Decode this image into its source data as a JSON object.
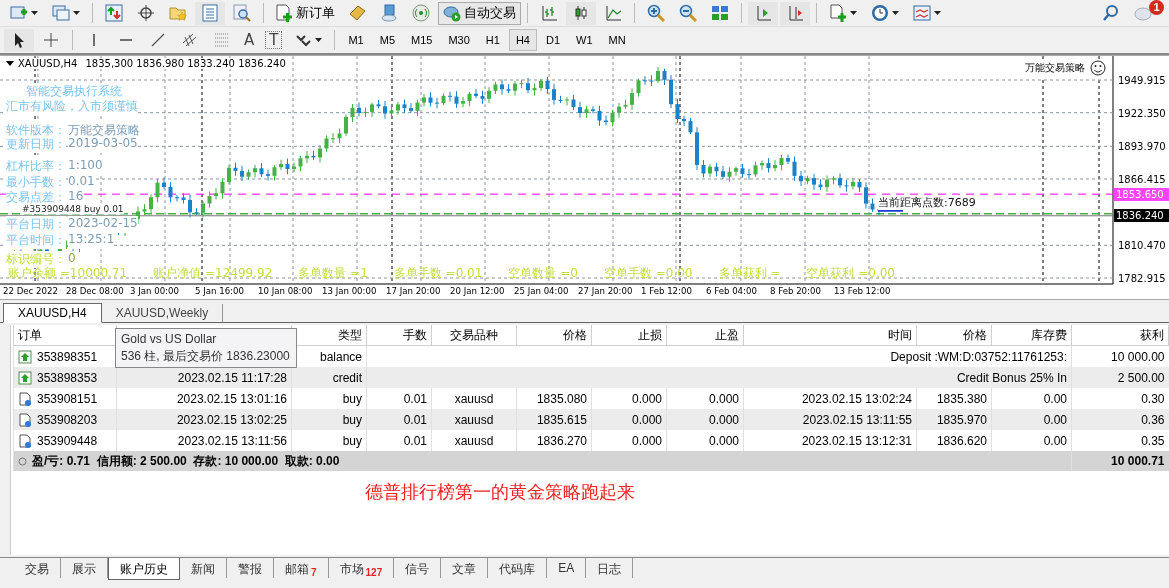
{
  "toolbar": {
    "new_order": "新订单",
    "auto_trading": "自动交易",
    "timeframes": [
      {
        "label": "M1",
        "selected": false
      },
      {
        "label": "M5",
        "selected": false
      },
      {
        "label": "M15",
        "selected": false
      },
      {
        "label": "M30",
        "selected": false
      },
      {
        "label": "H1",
        "selected": false
      },
      {
        "label": "H4",
        "selected": true
      },
      {
        "label": "D1",
        "selected": false
      },
      {
        "label": "W1",
        "selected": false
      },
      {
        "label": "MN",
        "selected": false
      }
    ],
    "text_tools": [
      "A",
      "T"
    ],
    "notification_count": "1"
  },
  "chart": {
    "symbol": "XAUUSD,H4",
    "ohlc": "1835,300 1836.980 1833.240 1836.240",
    "top_right": "万能交易策略",
    "info_lines": [
      {
        "kind": "heading",
        "label": "智能交易执行系统"
      },
      {
        "kind": "heading",
        "label": "汇市有风险，入市须谨慎"
      },
      {
        "kind": "field",
        "label": "软件版本：",
        "value": "万能交易策略"
      },
      {
        "kind": "field",
        "label": "更新日期：",
        "value": "2019-03-05"
      },
      {
        "kind": "field",
        "label": "杠杆比率：",
        "value": "1:100"
      },
      {
        "kind": "field",
        "label": "最小手数：",
        "value": "0.01"
      },
      {
        "kind": "field",
        "label": "交易点差：",
        "value": "16"
      },
      {
        "kind": "field",
        "label": "平台日期：",
        "value": "2023-02-15"
      },
      {
        "kind": "field",
        "label": "平台时间：",
        "value": "13:25:1"
      },
      {
        "kind": "id",
        "label": "标识编号：",
        "value": "0"
      }
    ],
    "trade_label": "#353909448 buy 0.01",
    "distance_label": "当前距离点数:7689",
    "stats": [
      "账户余额 =10000.71",
      "账户净值 =12499.92",
      "多单数量 =1",
      "多单手数 =0.01",
      "空单数量 =0",
      "空单手数 =0.00",
      "多单获利 =",
      "空单获利 =0.00"
    ],
    "price_labels": [
      "1949.915",
      "1922.350",
      "1893.970",
      "1866.415",
      "1810.470",
      "1782.915"
    ],
    "ask_badge": "1853.650",
    "bid_badge": "1836.240",
    "time_labels": [
      "22 Dec 2022",
      "28 Dec 08:00",
      "3 Jan 00:00",
      "5 Jan 16:00",
      "10 Jan 08:00",
      "13 Jan 00:00",
      "17 Jan 20:00",
      "20 Jan 12:00",
      "25 Jan 04:00",
      "27 Jan 20:00",
      "1 Feb 12:00",
      "6 Feb 04:00",
      "8 Feb 20:00",
      "13 Feb 12:00"
    ]
  },
  "chart_tabs": [
    {
      "label": "XAUUSD,H4",
      "selected": true
    },
    {
      "label": "XAUUSD,Weekly",
      "selected": false
    }
  ],
  "terminal": {
    "columns": [
      "订单",
      "",
      "类型",
      "手数",
      "交易品种",
      "价格",
      "止损",
      "止盈",
      "时间",
      "价格",
      "库存费",
      "获利"
    ],
    "tooltip": {
      "title": "Gold vs US Dollar",
      "detail": "536 柱, 最后交易价 1836.23000"
    },
    "rows": [
      {
        "kind": "deposit",
        "order": "353898351",
        "open_time": "",
        "type": "balance",
        "comment": "Deposit :WM:D:03752:11761253:",
        "profit": "10 000.00"
      },
      {
        "kind": "deposit",
        "order": "353898353",
        "open_time": "2023.02.15 11:17:28",
        "type": "credit",
        "comment": "Credit Bonus 25% In",
        "profit": "2 500.00"
      },
      {
        "kind": "trade",
        "order": "353908151",
        "open_time": "2023.02.15 13:01:16",
        "type": "buy",
        "lots": "0.01",
        "symbol": "xauusd",
        "price": "1835.080",
        "sl": "0.000",
        "tp": "0.000",
        "close_time": "2023.02.15 13:02:24",
        "close_price": "1835.380",
        "swap": "0.00",
        "profit": "0.30"
      },
      {
        "kind": "trade",
        "order": "353908203",
        "open_time": "2023.02.15 13:02:25",
        "type": "buy",
        "lots": "0.01",
        "symbol": "xauusd",
        "price": "1835.615",
        "sl": "0.000",
        "tp": "0.000",
        "close_time": "2023.02.15 13:11:55",
        "close_price": "1835.970",
        "swap": "0.00",
        "profit": "0.36"
      },
      {
        "kind": "trade",
        "order": "353909448",
        "open_time": "2023.02.15 13:11:56",
        "type": "buy",
        "lots": "0.01",
        "symbol": "xauusd",
        "price": "1836.270",
        "sl": "0.000",
        "tp": "0.000",
        "close_time": "2023.02.15 13:12:31",
        "close_price": "1836.620",
        "swap": "0.00",
        "profit": "0.35"
      }
    ],
    "summary": "盈/亏: 0.71  信用额: 2 500.00  存款: 10 000.00  取款: 0.00",
    "summary_total": "10 000.71"
  },
  "caption": "德普排行榜第一的黄金策略跑起来",
  "bottom_tabs": [
    {
      "label": "交易",
      "selected": false
    },
    {
      "label": "展示",
      "selected": false
    },
    {
      "label": "账户历史",
      "selected": true
    },
    {
      "label": "新闻",
      "selected": false
    },
    {
      "label": "警报",
      "selected": false
    },
    {
      "label": "邮箱",
      "badge": "7",
      "selected": false
    },
    {
      "label": "市场",
      "badge": "127",
      "selected": false
    },
    {
      "label": "信号",
      "selected": false
    },
    {
      "label": "文章",
      "selected": false
    },
    {
      "label": "代码库",
      "selected": false
    },
    {
      "label": "EA",
      "selected": false
    },
    {
      "label": "日志",
      "selected": false
    }
  ]
}
